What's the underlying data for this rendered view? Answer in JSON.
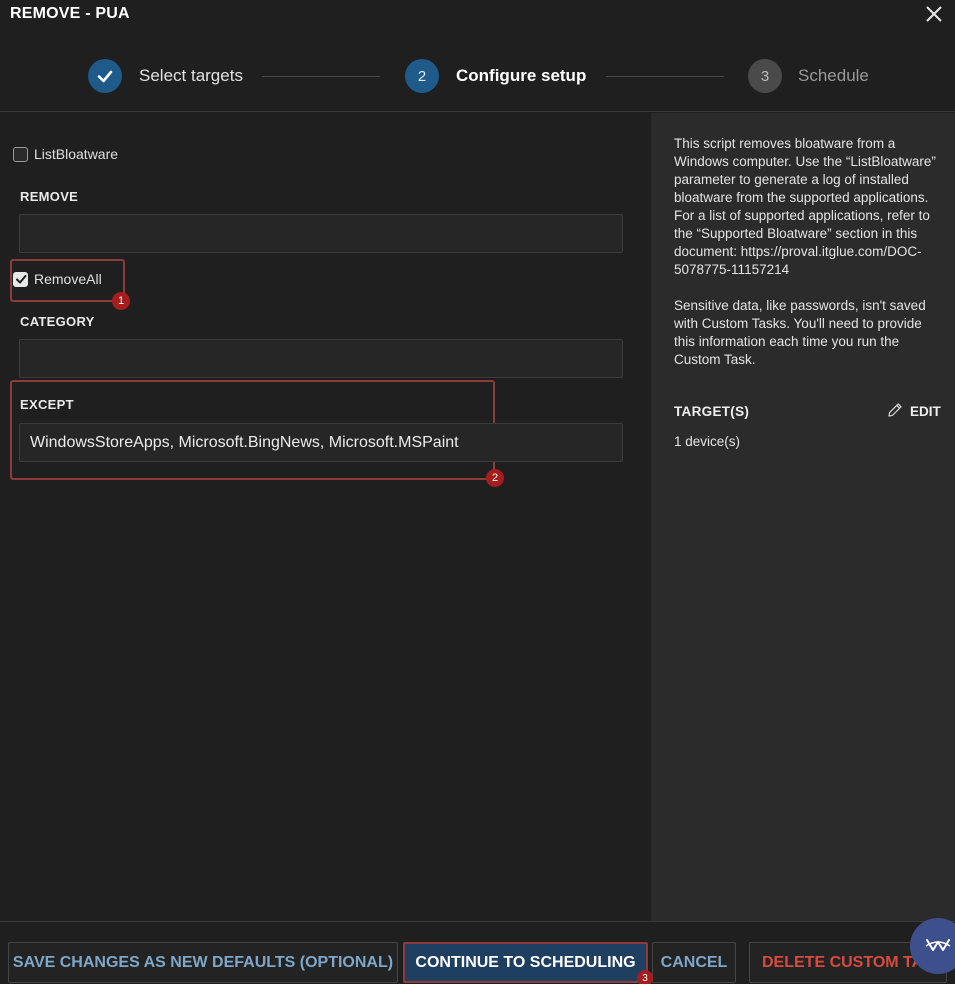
{
  "window": {
    "title": "REMOVE - PUA"
  },
  "stepper": {
    "steps": [
      {
        "number": "1",
        "label": "Select targets",
        "state": "complete"
      },
      {
        "number": "2",
        "label": "Configure setup",
        "state": "active"
      },
      {
        "number": "3",
        "label": "Schedule",
        "state": "pending"
      }
    ]
  },
  "form": {
    "list_bloatware": {
      "label": "ListBloatware",
      "checked": false
    },
    "remove": {
      "label": "REMOVE",
      "value": ""
    },
    "remove_all": {
      "label": "RemoveAll",
      "checked": true
    },
    "category": {
      "label": "CATEGORY",
      "value": ""
    },
    "except": {
      "label": "EXCEPT",
      "value": "WindowsStoreApps, Microsoft.BingNews, Microsoft.MSPaint"
    }
  },
  "annotations": {
    "badge1": "1",
    "badge2": "2",
    "badge3": "3"
  },
  "sidebar": {
    "description_1": "This script removes bloatware from a Windows computer. Use the “ListBloatware” parameter to generate a log of installed bloatware from the supported applications. For a list of supported applications, refer to the “Supported Bloatware” section in this document: https://proval.itglue.com/DOC-5078775-11157214",
    "description_2": "Sensitive data, like passwords, isn't saved with Custom Tasks. You'll need to provide this information each time you run the Custom Task.",
    "targets_title": "TARGET(S)",
    "edit_label": "EDIT",
    "targets_count": "1 device(s)"
  },
  "footer": {
    "save_defaults": "SAVE CHANGES AS NEW DEFAULTS (OPTIONAL)",
    "continue": "CONTINUE TO SCHEDULING",
    "cancel": "CANCEL",
    "delete": "DELETE CUSTOM TASK"
  },
  "colors": {
    "accent": "#1e5a8a",
    "step_pending": "#4a4a4a",
    "highlight_border": "#8e3b3b",
    "badge": "#a51d1d",
    "danger": "#d94a3f",
    "link": "#7ea7c9"
  }
}
